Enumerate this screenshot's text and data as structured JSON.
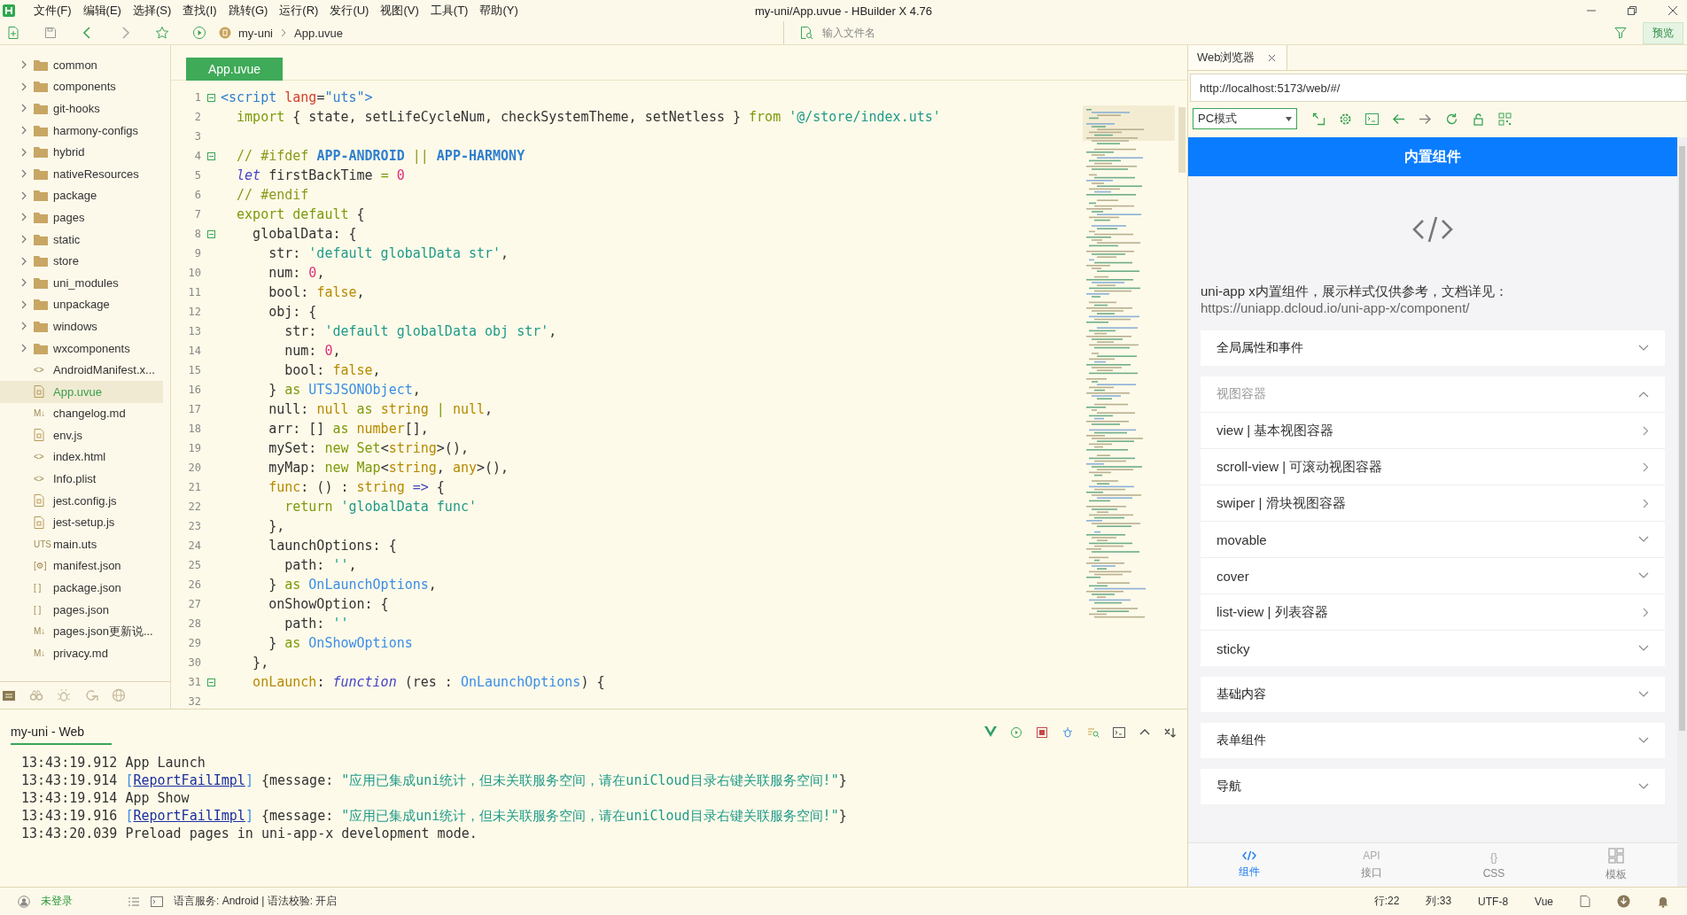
{
  "window": {
    "title": "my-uni/App.uvue - HBuilder X 4.76"
  },
  "menu": [
    "文件(F)",
    "编辑(E)",
    "选择(S)",
    "查找(I)",
    "跳转(G)",
    "运行(R)",
    "发行(U)",
    "视图(V)",
    "工具(T)",
    "帮助(Y)"
  ],
  "toolbar": {
    "breadcrumb": [
      "my-uni",
      "App.uvue"
    ],
    "file_search": {
      "placeholder": "输入文件名"
    },
    "preview_button": "预览"
  },
  "sidebar": {
    "items": [
      {
        "name": "common",
        "kind": "folder",
        "expanded": false,
        "selected": false
      },
      {
        "name": "components",
        "kind": "folder",
        "expanded": false,
        "selected": false
      },
      {
        "name": "git-hooks",
        "kind": "folder",
        "expanded": false,
        "selected": false
      },
      {
        "name": "harmony-configs",
        "kind": "folder",
        "expanded": false,
        "selected": false
      },
      {
        "name": "hybrid",
        "kind": "folder",
        "expanded": false,
        "selected": false
      },
      {
        "name": "nativeResources",
        "kind": "folder",
        "expanded": false,
        "selected": false
      },
      {
        "name": "package",
        "kind": "folder",
        "expanded": false,
        "selected": false
      },
      {
        "name": "pages",
        "kind": "folder",
        "expanded": false,
        "selected": false
      },
      {
        "name": "static",
        "kind": "folder",
        "expanded": false,
        "selected": false
      },
      {
        "name": "store",
        "kind": "folder",
        "expanded": false,
        "selected": false
      },
      {
        "name": "uni_modules",
        "kind": "folder",
        "expanded": false,
        "selected": false
      },
      {
        "name": "unpackage",
        "kind": "folder",
        "expanded": false,
        "selected": false
      },
      {
        "name": "windows",
        "kind": "folder",
        "expanded": false,
        "selected": false
      },
      {
        "name": "wxcomponents",
        "kind": "folder",
        "expanded": false,
        "selected": false
      },
      {
        "name": "AndroidManifest.x...",
        "kind": "file",
        "glyph": "<>",
        "selected": false
      },
      {
        "name": "App.uvue",
        "kind": "file",
        "selected": true
      },
      {
        "name": "changelog.md",
        "kind": "file",
        "glyph": "M↓",
        "selected": false
      },
      {
        "name": "env.js",
        "kind": "file",
        "selected": false
      },
      {
        "name": "index.html",
        "kind": "file",
        "glyph": "<>",
        "selected": false
      },
      {
        "name": "Info.plist",
        "kind": "file",
        "glyph": "<>",
        "selected": false
      },
      {
        "name": "jest.config.js",
        "kind": "file",
        "selected": false
      },
      {
        "name": "jest-setup.js",
        "kind": "file",
        "selected": false
      },
      {
        "name": "main.uts",
        "kind": "file",
        "glyph": "UTS",
        "selected": false
      },
      {
        "name": "manifest.json",
        "kind": "file",
        "glyph": "[⚙]",
        "selected": false
      },
      {
        "name": "package.json",
        "kind": "file",
        "glyph": "[ ]",
        "selected": false
      },
      {
        "name": "pages.json",
        "kind": "file",
        "glyph": "[ ]",
        "selected": false
      },
      {
        "name": "pages.json更新说...",
        "kind": "file",
        "glyph": "M↓",
        "selected": false
      },
      {
        "name": "privacy.md",
        "kind": "file",
        "glyph": "M↓",
        "selected": false
      }
    ]
  },
  "editor": {
    "tab": "App.uvue",
    "lines": [
      {
        "number": "1",
        "foldable": true,
        "tokens": [
          {
            "kind": "tag",
            "text": "<script "
          },
          {
            "kind": "attr",
            "text": "lang"
          },
          {
            "kind": "plain",
            "text": "="
          },
          {
            "kind": "tag",
            "text": "\"uts\">"
          }
        ]
      },
      {
        "number": "2",
        "foldable": false,
        "tokens": [
          {
            "kind": "kw",
            "text": "  import"
          },
          {
            "kind": "plain",
            "text": " { state, setLifeCycleNum, checkSystemTheme, setNetless } "
          },
          {
            "kind": "kw",
            "text": "from "
          },
          {
            "kind": "str",
            "text": "'@/store/index.uts'"
          }
        ]
      },
      {
        "number": "3",
        "foldable": false
      },
      {
        "number": "4",
        "foldable": true,
        "tokens": [
          {
            "kind": "comment",
            "text": "  // #ifdef "
          },
          {
            "kind": "pp",
            "text": "APP-ANDROID"
          },
          {
            "kind": "comment",
            "text": " || "
          },
          {
            "kind": "pp",
            "text": "APP-HARMONY"
          }
        ]
      },
      {
        "number": "5",
        "foldable": false,
        "tokens": [
          {
            "kind": "fn",
            "text": "  let"
          },
          {
            "kind": "plain",
            "text": " firstBackTime "
          },
          {
            "kind": "kw",
            "text": "= "
          },
          {
            "kind": "num",
            "text": "0"
          }
        ]
      },
      {
        "number": "6",
        "foldable": false,
        "tokens": [
          {
            "kind": "comment",
            "text": "  // #endif"
          }
        ]
      },
      {
        "number": "7",
        "foldable": false,
        "tokens": [
          {
            "kind": "kw",
            "text": "  export default"
          },
          {
            "kind": "plain",
            "text": " {"
          }
        ]
      },
      {
        "number": "8",
        "foldable": true,
        "tokens": [
          {
            "kind": "plain",
            "text": "    globalData: {"
          }
        ]
      },
      {
        "number": "9",
        "foldable": false,
        "tokens": [
          {
            "kind": "plain",
            "text": "      str: "
          },
          {
            "kind": "str",
            "text": "'default globalData str'"
          },
          {
            "kind": "plain",
            "text": ","
          }
        ]
      },
      {
        "number": "10",
        "foldable": false,
        "tokens": [
          {
            "kind": "plain",
            "text": "      num: "
          },
          {
            "kind": "num",
            "text": "0"
          },
          {
            "kind": "plain",
            "text": ","
          }
        ]
      },
      {
        "number": "11",
        "foldable": false,
        "tokens": [
          {
            "kind": "plain",
            "text": "      bool: "
          },
          {
            "kind": "lit",
            "text": "false"
          },
          {
            "kind": "plain",
            "text": ","
          }
        ]
      },
      {
        "number": "12",
        "foldable": false,
        "tokens": [
          {
            "kind": "plain",
            "text": "      obj: {"
          }
        ]
      },
      {
        "number": "13",
        "foldable": false,
        "tokens": [
          {
            "kind": "plain",
            "text": "        str: "
          },
          {
            "kind": "str",
            "text": "'default globalData obj str'"
          },
          {
            "kind": "plain",
            "text": ","
          }
        ]
      },
      {
        "number": "14",
        "foldable": false,
        "tokens": [
          {
            "kind": "plain",
            "text": "        num: "
          },
          {
            "kind": "num",
            "text": "0"
          },
          {
            "kind": "plain",
            "text": ","
          }
        ]
      },
      {
        "number": "15",
        "foldable": false,
        "tokens": [
          {
            "kind": "plain",
            "text": "        bool: "
          },
          {
            "kind": "lit",
            "text": "false"
          },
          {
            "kind": "plain",
            "text": ","
          }
        ]
      },
      {
        "number": "16",
        "foldable": false,
        "tokens": [
          {
            "kind": "plain",
            "text": "      } "
          },
          {
            "kind": "kw",
            "text": "as "
          },
          {
            "kind": "type",
            "text": "UTSJSONObject"
          },
          {
            "kind": "plain",
            "text": ","
          }
        ]
      },
      {
        "number": "17",
        "foldable": false,
        "tokens": [
          {
            "kind": "plain",
            "text": "      null: "
          },
          {
            "kind": "lit",
            "text": "null "
          },
          {
            "kind": "kw",
            "text": "as "
          },
          {
            "kind": "lit",
            "text": "string "
          },
          {
            "kind": "kw",
            "text": "| "
          },
          {
            "kind": "lit",
            "text": "null"
          },
          {
            "kind": "plain",
            "text": ","
          }
        ]
      },
      {
        "number": "18",
        "foldable": false,
        "tokens": [
          {
            "kind": "plain",
            "text": "      arr: [] "
          },
          {
            "kind": "kw",
            "text": "as "
          },
          {
            "kind": "lit",
            "text": "number"
          },
          {
            "kind": "plain",
            "text": "[],"
          }
        ]
      },
      {
        "number": "19",
        "foldable": false,
        "tokens": [
          {
            "kind": "plain",
            "text": "      mySet: "
          },
          {
            "kind": "kw",
            "text": "new Set"
          },
          {
            "kind": "plain",
            "text": "<"
          },
          {
            "kind": "lit",
            "text": "string"
          },
          {
            "kind": "plain",
            "text": ">(),"
          }
        ]
      },
      {
        "number": "20",
        "foldable": false,
        "tokens": [
          {
            "kind": "plain",
            "text": "      myMap: "
          },
          {
            "kind": "kw",
            "text": "new Map"
          },
          {
            "kind": "plain",
            "text": "<"
          },
          {
            "kind": "lit",
            "text": "string"
          },
          {
            "kind": "plain",
            "text": ", "
          },
          {
            "kind": "lit",
            "text": "any"
          },
          {
            "kind": "plain",
            "text": ">(),"
          }
        ]
      },
      {
        "number": "21",
        "foldable": false,
        "tokens": [
          {
            "kind": "lit",
            "text": "      func"
          },
          {
            "kind": "plain",
            "text": ": () : "
          },
          {
            "kind": "lit",
            "text": "string "
          },
          {
            "kind": "fn",
            "text": "=>"
          },
          {
            "kind": "plain",
            "text": " {"
          }
        ]
      },
      {
        "number": "22",
        "foldable": false,
        "tokens": [
          {
            "kind": "kw",
            "text": "        return "
          },
          {
            "kind": "str",
            "text": "'globalData func'"
          }
        ]
      },
      {
        "number": "23",
        "foldable": false,
        "tokens": [
          {
            "kind": "plain",
            "text": "      },"
          }
        ]
      },
      {
        "number": "24",
        "foldable": false,
        "tokens": [
          {
            "kind": "plain",
            "text": "      launchOptions: {"
          }
        ]
      },
      {
        "number": "25",
        "foldable": false,
        "tokens": [
          {
            "kind": "plain",
            "text": "        path: "
          },
          {
            "kind": "str",
            "text": "''"
          },
          {
            "kind": "plain",
            "text": ","
          }
        ]
      },
      {
        "number": "26",
        "foldable": false,
        "tokens": [
          {
            "kind": "plain",
            "text": "      } "
          },
          {
            "kind": "kw",
            "text": "as "
          },
          {
            "kind": "type",
            "text": "OnLaunchOptions"
          },
          {
            "kind": "plain",
            "text": ","
          }
        ]
      },
      {
        "number": "27",
        "foldable": false,
        "tokens": [
          {
            "kind": "plain",
            "text": "      onShowOption: {"
          }
        ]
      },
      {
        "number": "28",
        "foldable": false,
        "tokens": [
          {
            "kind": "plain",
            "text": "        path: "
          },
          {
            "kind": "str",
            "text": "''"
          }
        ]
      },
      {
        "number": "29",
        "foldable": false,
        "tokens": [
          {
            "kind": "plain",
            "text": "      } "
          },
          {
            "kind": "kw",
            "text": "as "
          },
          {
            "kind": "type",
            "text": "OnShowOptions"
          }
        ]
      },
      {
        "number": "30",
        "foldable": false,
        "tokens": [
          {
            "kind": "plain",
            "text": "    },"
          }
        ]
      },
      {
        "number": "31",
        "foldable": true,
        "tokens": [
          {
            "kind": "lit",
            "text": "    onLaunch"
          },
          {
            "kind": "plain",
            "text": ": "
          },
          {
            "kind": "fn",
            "text": "function"
          },
          {
            "kind": "plain",
            "text": " (res : "
          },
          {
            "kind": "type",
            "text": "OnLaunchOptions"
          },
          {
            "kind": "plain",
            "text": ") {"
          }
        ]
      },
      {
        "number": "32",
        "foldable": false
      }
    ]
  },
  "console": {
    "tab": "my-uni - Web",
    "lines": [
      {
        "tokens": [
          {
            "kind": "plain",
            "text": "13:43:19.912 App Launch"
          }
        ]
      },
      {
        "tokens": [
          {
            "kind": "plain",
            "text": "13:43:19.914 "
          },
          {
            "kind": "type",
            "text": "["
          },
          {
            "kind": "link",
            "text": "ReportFailImpl"
          },
          {
            "kind": "type",
            "text": "]"
          },
          {
            "kind": "plain",
            "text": " {message: "
          },
          {
            "kind": "str",
            "text": "\"应用已集成uni统计，但未关联服务空间，请在uniCloud目录右键关联服务空间!\""
          },
          {
            "kind": "plain",
            "text": "}"
          }
        ]
      },
      {
        "tokens": [
          {
            "kind": "plain",
            "text": "13:43:19.914 App Show"
          }
        ]
      },
      {
        "tokens": [
          {
            "kind": "plain",
            "text": "13:43:19.916 "
          },
          {
            "kind": "type",
            "text": "["
          },
          {
            "kind": "link",
            "text": "ReportFailImpl"
          },
          {
            "kind": "type",
            "text": "]"
          },
          {
            "kind": "plain",
            "text": " {message: "
          },
          {
            "kind": "str",
            "text": "\"应用已集成uni统计，但未关联服务空间，请在uniCloud目录右键关联服务空间!\""
          },
          {
            "kind": "plain",
            "text": "}"
          }
        ]
      },
      {
        "tokens": [
          {
            "kind": "plain",
            "text": "13:43:20.039 Preload pages in uni-app-x development mode."
          }
        ]
      }
    ]
  },
  "browser": {
    "tab": "Web浏览器",
    "url": "http://localhost:5173/web/#/",
    "mode": "PC模式",
    "page": {
      "title": "内置组件",
      "intro": "uni-app x内置组件，展示样式仅供参考，文档详见：",
      "link": "https://uniapp.dcloud.io/uni-app-x/component/",
      "sections": [
        {
          "title": "全局属性和事件",
          "expanded": false
        },
        {
          "title": "视图容器",
          "expanded": true,
          "items": [
            {
              "label": "view | 基本视图容器",
              "kind": "page"
            },
            {
              "label": "scroll-view | 可滚动视图容器",
              "kind": "page"
            },
            {
              "label": "swiper | 滑块视图容器",
              "kind": "page"
            },
            {
              "label": "movable",
              "kind": "group"
            },
            {
              "label": "cover",
              "kind": "group"
            },
            {
              "label": "list-view | 列表容器",
              "kind": "page"
            },
            {
              "label": "sticky",
              "kind": "group"
            }
          ]
        },
        {
          "title": "基础内容",
          "expanded": false
        },
        {
          "title": "表单组件",
          "expanded": false
        },
        {
          "title": "导航",
          "expanded": false
        }
      ],
      "tabs": [
        {
          "label": "组件",
          "selected": true
        },
        {
          "label": "接口",
          "selected": false,
          "glyph": "API"
        },
        {
          "label": "CSS",
          "selected": false,
          "glyph": "{}"
        },
        {
          "label": "模板",
          "selected": false
        }
      ]
    }
  },
  "status_bar": {
    "login": "未登录",
    "language_service": "语言服务: Android | 语法校验: 开启",
    "line": "行:22",
    "column": "列:33",
    "encoding": "UTF-8",
    "language": "Vue"
  }
}
